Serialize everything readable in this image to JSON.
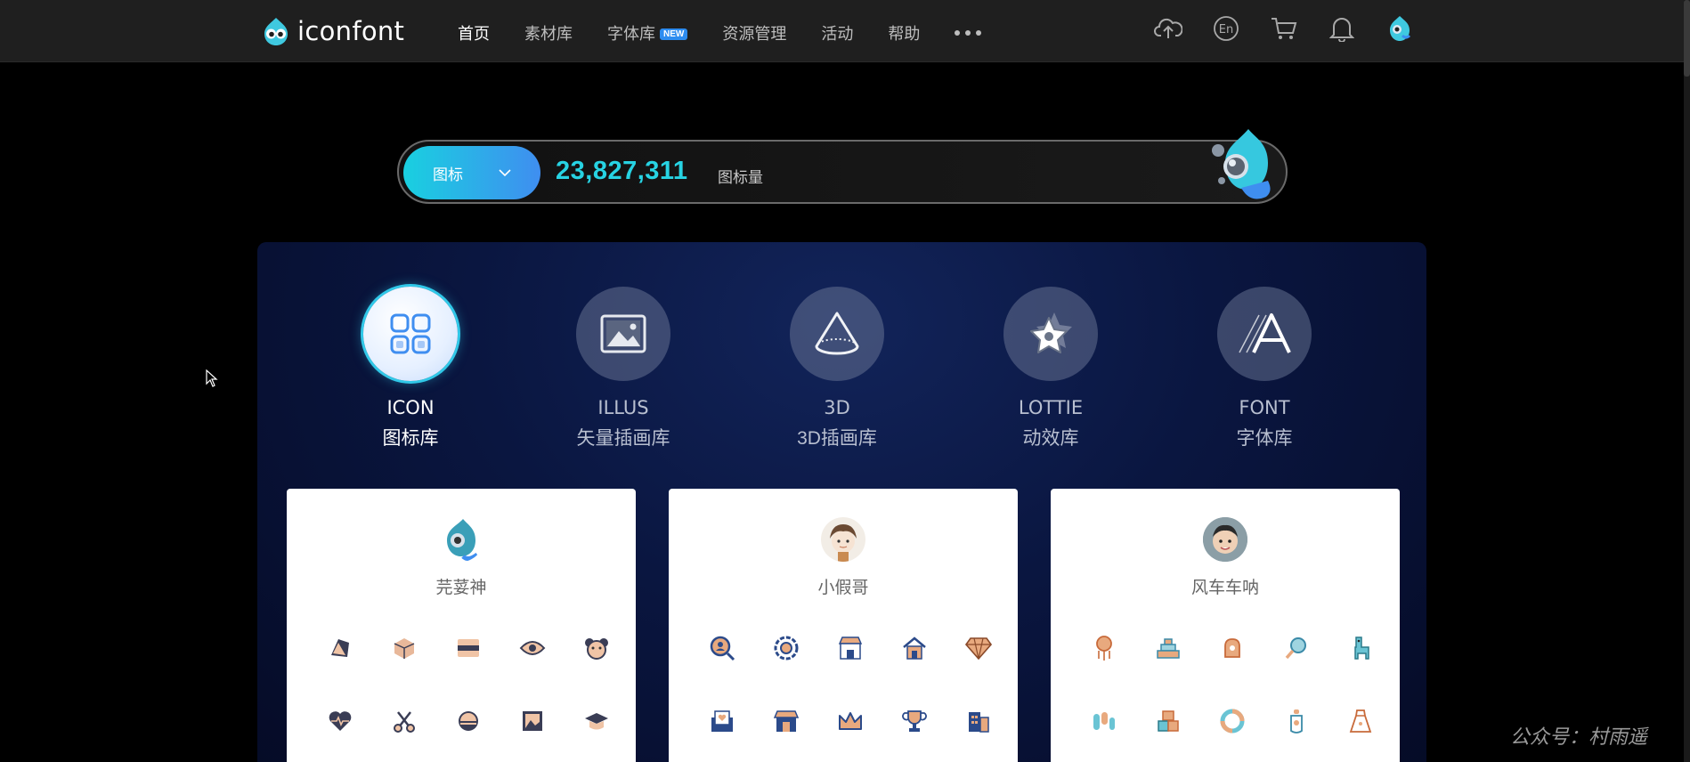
{
  "header": {
    "logo_text": "iconfont",
    "nav": [
      {
        "label": "首页",
        "active": true
      },
      {
        "label": "素材库",
        "active": false
      },
      {
        "label": "字体库",
        "active": false,
        "badge": "NEW"
      },
      {
        "label": "资源管理",
        "active": false
      },
      {
        "label": "活动",
        "active": false
      },
      {
        "label": "帮助",
        "active": false
      }
    ],
    "right_icons": [
      "upload-cloud-icon",
      "language-en-icon",
      "cart-icon",
      "bell-icon",
      "user-avatar-icon"
    ],
    "lang_label": "En"
  },
  "hero": {
    "select_label": "图标",
    "count": "23,827,311",
    "count_unit": "图标量"
  },
  "categories": [
    {
      "en": "ICON",
      "zh": "图标库",
      "active": true,
      "icon": "grid-four-icon"
    },
    {
      "en": "ILLUS",
      "zh": "矢量插画库",
      "active": false,
      "icon": "picture-icon"
    },
    {
      "en": "3D",
      "zh": "3D插画库",
      "active": false,
      "icon": "cone-icon"
    },
    {
      "en": "LOTTIE",
      "zh": "动效库",
      "active": false,
      "icon": "star-motion-icon"
    },
    {
      "en": "FONT",
      "zh": "字体库",
      "active": false,
      "icon": "letter-a-icon"
    }
  ],
  "cards": [
    {
      "name": "芫荽神",
      "avatar": "mascot-avatar"
    },
    {
      "name": "小假哥",
      "avatar": "boy-avatar"
    },
    {
      "name": "风车车呐",
      "avatar": "child-avatar"
    }
  ],
  "watermark": "公众号：村雨遥",
  "colors": {
    "accent_cyan": "#27d3e3",
    "accent_blue": "#3f8ef0",
    "panel_bg": "#0a1640",
    "topbar_bg": "#1f1f1f"
  }
}
